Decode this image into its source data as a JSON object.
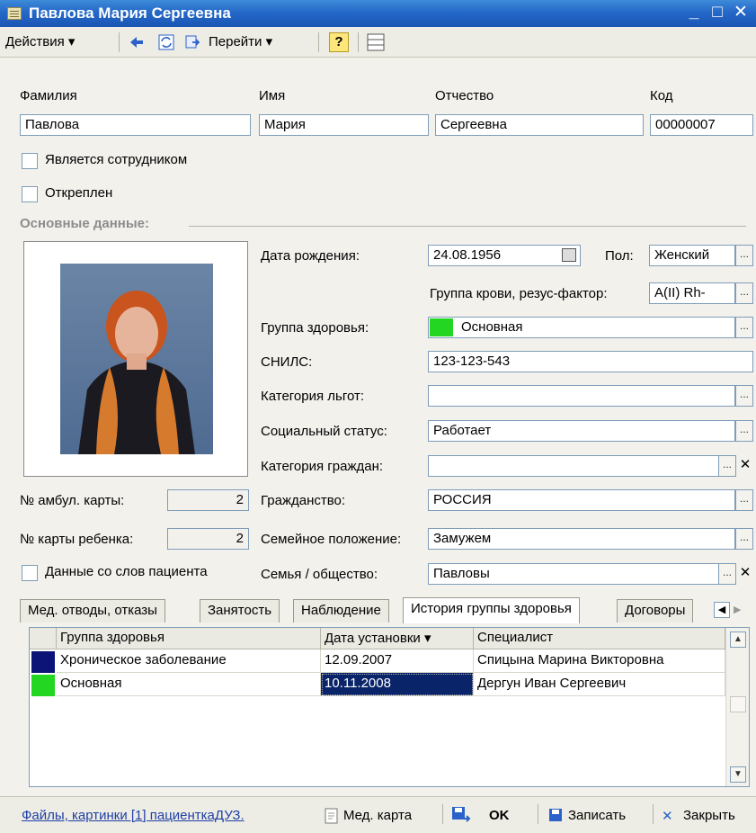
{
  "window": {
    "title": "Павлова  Мария Сергеевна"
  },
  "toolbar": {
    "actions": "Действия ▾",
    "goto": "Перейти ▾",
    "help": "?"
  },
  "name": {
    "last_label": "Фамилия",
    "last_value": "Павлова",
    "first_label": "Имя",
    "first_value": "Мария",
    "middle_label": "Отчество",
    "middle_value": "Сергеевна",
    "code_label": "Код",
    "code_value": "00000007"
  },
  "flags": {
    "employee": "Является сотрудником",
    "detached": "Откреплен"
  },
  "section": {
    "main": "Основные данные:"
  },
  "fields": {
    "birth_label": "Дата рождения:",
    "birth_value": "24.08.1956",
    "sex_label": "Пол:",
    "sex_value": "Женский",
    "blood_label": "Группа крови, резус-фактор:",
    "blood_value": "A(II) Rh-",
    "health_label": "Группа здоровья:",
    "health_value": "Основная",
    "snils_label": "СНИЛС:",
    "snils_value": "123-123-543",
    "benefit_label": "Категория льгот:",
    "benefit_value": "",
    "social_label": "Социальный статус:",
    "social_value": "Работает",
    "citizen_cat_label": "Категория граждан:",
    "citizen_cat_value": "",
    "citizenship_label": "Гражданство:",
    "citizenship_value": "РОССИЯ",
    "marital_label": "Семейное положение:",
    "marital_value": "Замужем",
    "family_label": "Семья / общество:",
    "family_value": "Павловы"
  },
  "left": {
    "amb_label": "№ амбул. карты:",
    "amb_value": "2",
    "child_label": "№ карты ребенка:",
    "child_value": "2",
    "patient_words": "Данные со слов пациента"
  },
  "tabs": [
    "Мед. отводы, отказы",
    "Занятость",
    "Наблюдение",
    "История группы здоровья",
    "Договоры"
  ],
  "grid": {
    "headers": [
      "Группа здоровья",
      "Дата установки  ▾",
      "Специалист"
    ],
    "rows": [
      {
        "group": "Хроническое заболевание",
        "date": "12.09.2007",
        "specialist": "Спицына Марина Викторовна",
        "color": "#0c1577"
      },
      {
        "group": "Основная",
        "date": "10.11.2008",
        "specialist": "Дергун Иван Сергеевич",
        "color": "#22d622"
      }
    ]
  },
  "status": {
    "files": "Файлы, картинки [1] пациенткаДУЗ.",
    "medcard": "Мед. карта",
    "ok": "OK",
    "save": "Записать",
    "close": "Закрыть"
  },
  "colors": {
    "title_bar": "#2468c8",
    "health_green": "#22d622",
    "selection": "#0a246a"
  }
}
